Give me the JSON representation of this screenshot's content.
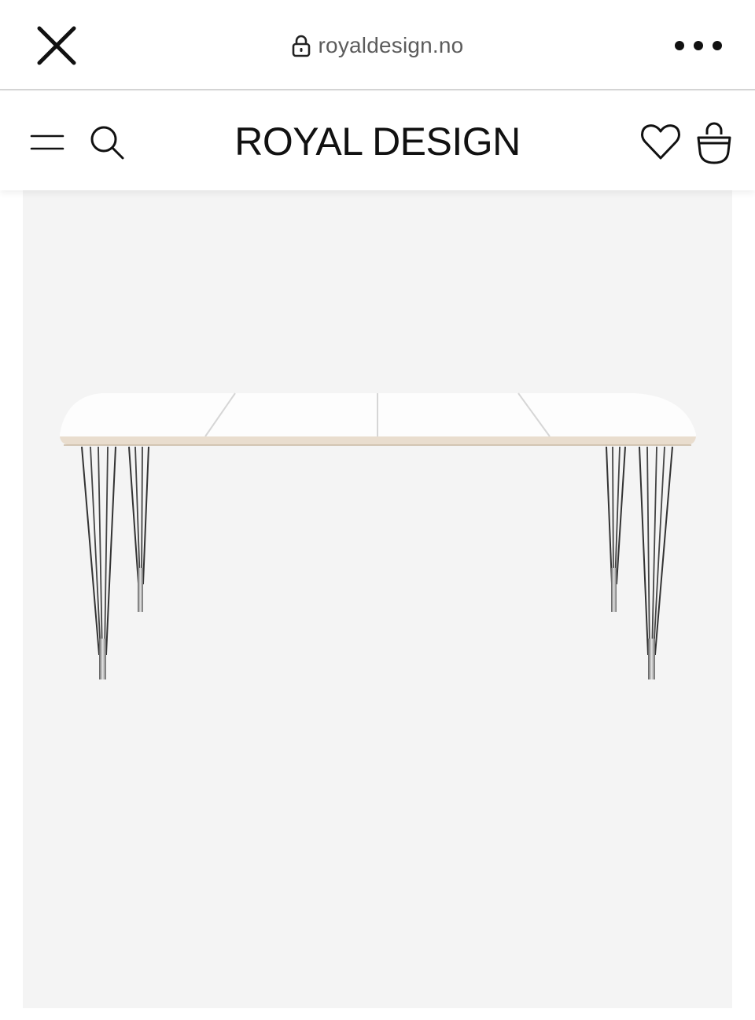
{
  "browser": {
    "url": "royaldesign.no",
    "icons": {
      "close": "close-icon",
      "lock": "lock-icon",
      "more": "more-dots-icon"
    }
  },
  "header": {
    "logo_text": "ROYAL DESIGN",
    "icons": {
      "menu": "hamburger-menu-icon",
      "search": "search-icon",
      "wishlist": "heart-icon",
      "cart": "shopping-bag-icon"
    }
  },
  "product": {
    "image_subject": "white extendable dining table with chrome spider legs",
    "background_color": "#f4f4f4"
  }
}
